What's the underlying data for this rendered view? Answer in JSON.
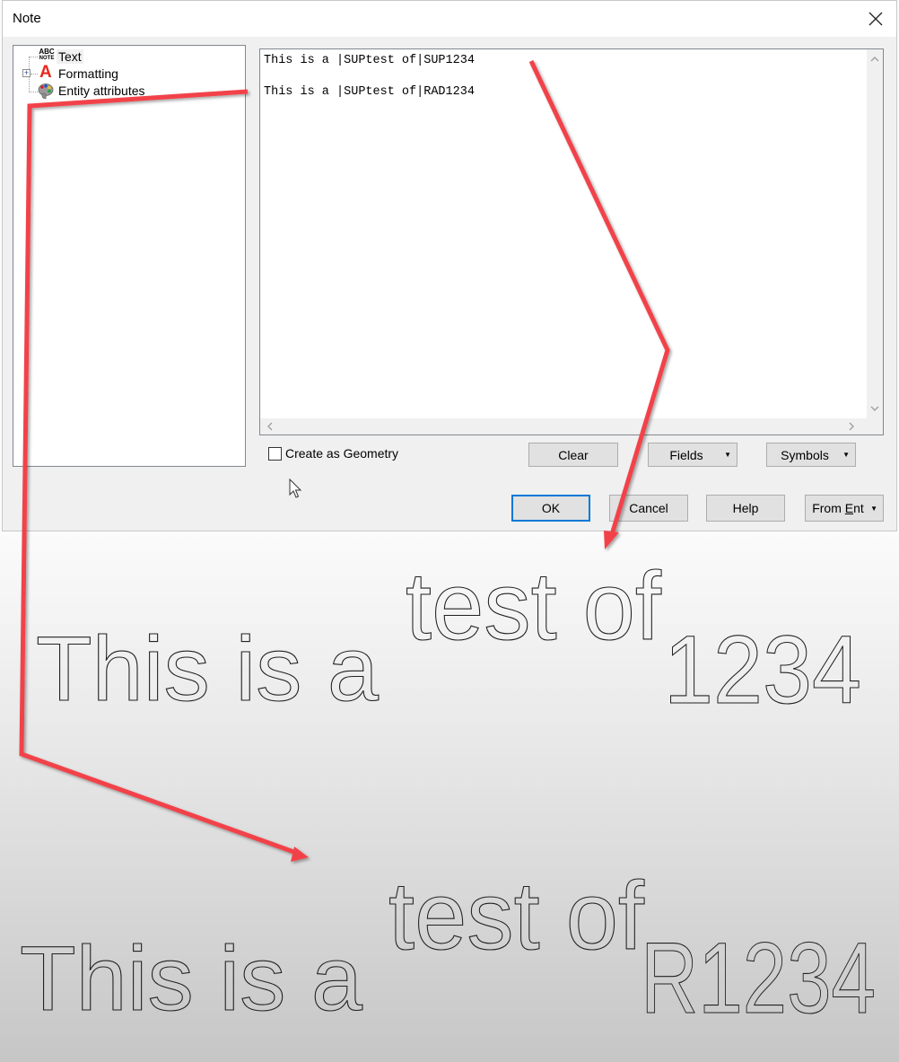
{
  "dialog": {
    "title": "Note",
    "close_icon": "close-icon"
  },
  "tree": {
    "items": [
      {
        "label": "Text",
        "icon": "abc-note-icon",
        "selected": true
      },
      {
        "label": "Formatting",
        "icon": "red-letter-a-icon",
        "expandable": true
      },
      {
        "label": "Entity attributes",
        "icon": "palette-icon"
      }
    ],
    "abc_icon_top": "ABC",
    "abc_icon_bottom": "NOTE",
    "format_icon_glyph": "A"
  },
  "editor": {
    "lines": [
      "This is a |SUPtest of|SUP1234",
      "",
      "This is a |SUPtest of|RAD1234"
    ],
    "scroll_up_icon": "chevron-up-icon",
    "scroll_down_icon": "chevron-down-icon",
    "scroll_left_icon": "chevron-left-icon",
    "scroll_right_icon": "chevron-right-icon"
  },
  "options": {
    "create_as_geometry_label": "Create as Geometry",
    "create_as_geometry_checked": false
  },
  "buttons": {
    "clear": "Clear",
    "fields": "Fields",
    "symbols": "Symbols",
    "ok": "OK",
    "cancel": "Cancel",
    "help": "Help",
    "from_ent_prefix": "From ",
    "from_ent_mnemonic": "E",
    "from_ent_suffix": "nt",
    "dropdown_glyph": "▼"
  },
  "preview": {
    "sup_example": {
      "main": "This is a",
      "superscript": "test of",
      "trailing": "1234"
    },
    "rad_example": {
      "main": "This is a",
      "superscript": "test of",
      "trailing": "R1234"
    }
  },
  "annotations": {
    "arrow_color": "#f2424a"
  }
}
